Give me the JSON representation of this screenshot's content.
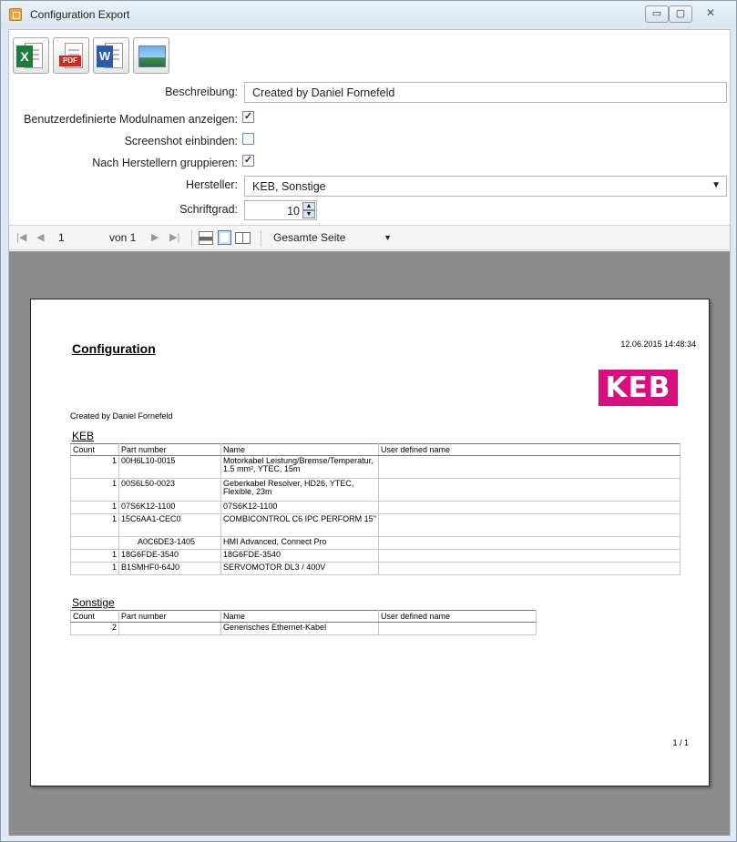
{
  "window": {
    "title": "Configuration Export",
    "controls": {
      "minimize": "▭",
      "maximize": "▢",
      "close": "✕"
    }
  },
  "export_toolbar": {
    "excel_label": "X",
    "pdf_label": "PDF",
    "word_label": "W"
  },
  "form": {
    "description_label": "Beschreibung:",
    "description_value": "Created by Daniel Fornefeld",
    "custom_module_names_label": "Benutzerdefinierte Modulnamen anzeigen:",
    "custom_module_names_checked": true,
    "include_screenshot_label": "Screenshot einbinden:",
    "include_screenshot_checked": false,
    "group_by_manufacturer_label": "Nach Herstellern gruppieren:",
    "group_by_manufacturer_checked": true,
    "manufacturer_label": "Hersteller:",
    "manufacturer_value": "KEB, Sonstige",
    "font_size_label": "Schriftgrad:",
    "font_size_value": "10"
  },
  "viewer_toolbar": {
    "first": "|◀",
    "prev": "◀",
    "page_value": "1",
    "of_label": "von 1",
    "next": "▶",
    "last": "▶|",
    "zoom_value": "Gesamte Seite"
  },
  "report": {
    "title": "Configuration",
    "timestamp": "12.06.2015 14:48:34",
    "logo_text": "KEB",
    "created_by": "Created by Daniel Fornefeld",
    "page_indicator": "1 / 1",
    "columns": [
      "Count",
      "Part number",
      "Name",
      "User defined name"
    ],
    "groups": [
      {
        "name": "KEB",
        "rows": [
          {
            "count": "1",
            "part": "00H6L10-0015",
            "name": "Motorkabel Leistung/Bremse/Temperatur, 1.5 mm², YTEC, 15m",
            "udn": ""
          },
          {
            "count": "1",
            "part": "00S6L50-0023",
            "name": "Geberkabel Resolver, HD26, YTEC, Flexible, 23m",
            "udn": ""
          },
          {
            "count": "1",
            "part": "07S6K12-1100",
            "name": "07S6K12-1100",
            "udn": ""
          },
          {
            "count": "1",
            "part": "15C6AA1-CEC0",
            "name": "COMBICONTROL C6 IPC PERFORM 15\"",
            "udn": ""
          },
          {
            "count": "",
            "part": "A0C6DE3-1405",
            "name": "HMI Advanced, Connect Pro",
            "udn": ""
          },
          {
            "count": "1",
            "part": "18G6FDE-3540",
            "name": "18G6FDE-3540",
            "udn": ""
          },
          {
            "count": "1",
            "part": "B1SMHF0-64J0",
            "name": "SERVOMOTOR DL3 / 400V",
            "udn": ""
          }
        ]
      },
      {
        "name": "Sonstige",
        "rows": [
          {
            "count": "2",
            "part": "",
            "name": "Generisches Ethernet-Kabel",
            "udn": ""
          }
        ]
      }
    ]
  }
}
